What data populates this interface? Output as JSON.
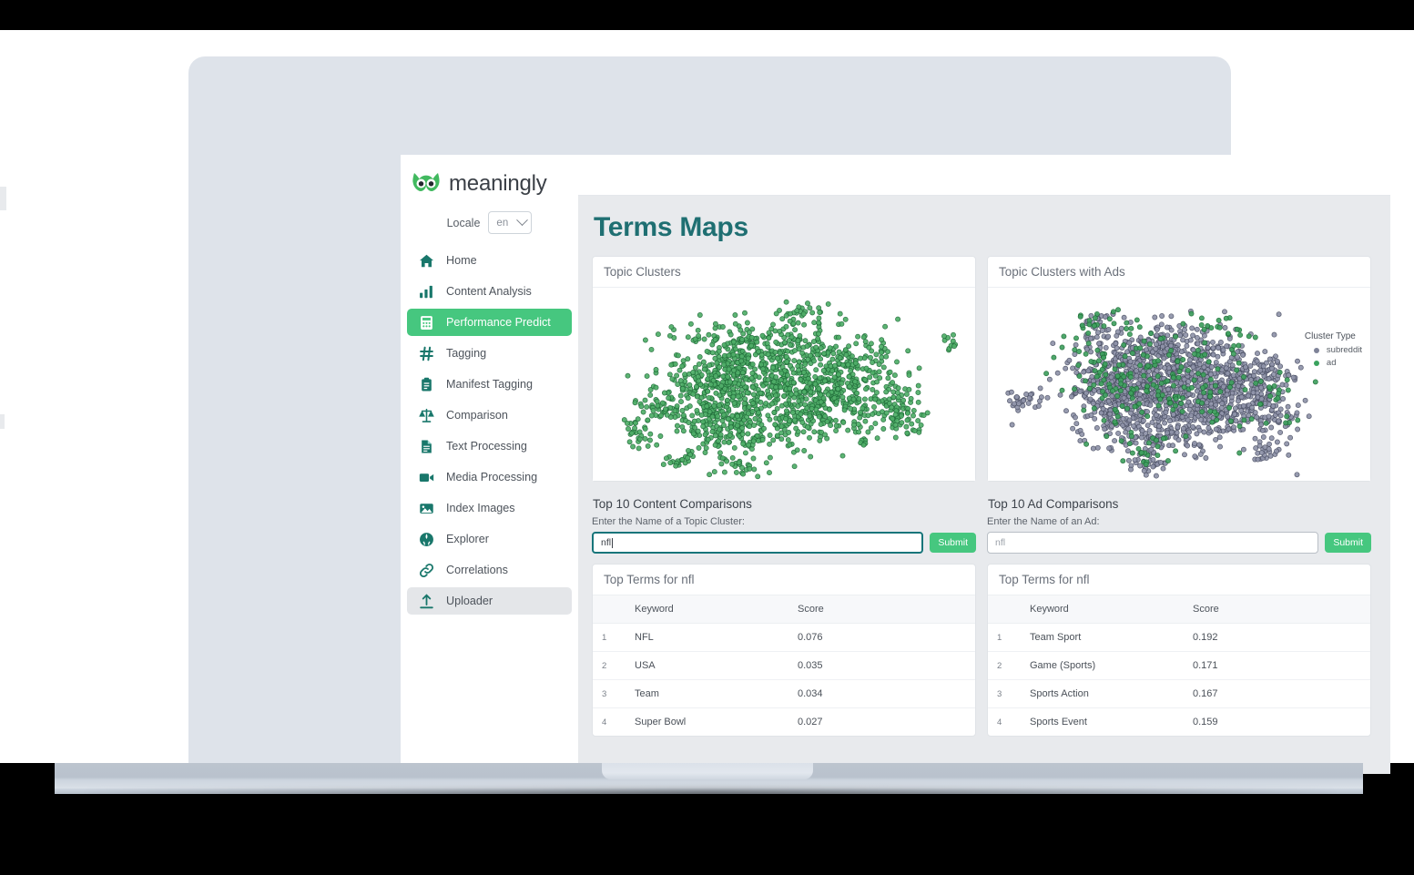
{
  "brand": {
    "name": "meaningly",
    "logo_icon": "owl-icon"
  },
  "locale": {
    "label": "Locale",
    "value": "en",
    "chevron_icon": "chevron-down-icon"
  },
  "sidebar": {
    "items": [
      {
        "label": "Home",
        "icon": "home-icon",
        "state": "default"
      },
      {
        "label": "Content Analysis",
        "icon": "bar-chart-icon",
        "state": "default"
      },
      {
        "label": "Performance Predict",
        "icon": "calculator-icon",
        "state": "active"
      },
      {
        "label": "Tagging",
        "icon": "hash-icon",
        "state": "default"
      },
      {
        "label": "Manifest Tagging",
        "icon": "clipboard-icon",
        "state": "default"
      },
      {
        "label": "Comparison",
        "icon": "scales-icon",
        "state": "default"
      },
      {
        "label": "Text Processing",
        "icon": "document-icon",
        "state": "default"
      },
      {
        "label": "Media Processing",
        "icon": "video-camera-icon",
        "state": "default"
      },
      {
        "label": "Index Images",
        "icon": "image-icon",
        "state": "default"
      },
      {
        "label": "Explorer",
        "icon": "globe-icon",
        "state": "default"
      },
      {
        "label": "Correlations",
        "icon": "link-icon",
        "state": "default"
      },
      {
        "label": "Uploader",
        "icon": "upload-icon",
        "state": "hover"
      }
    ]
  },
  "page": {
    "title": "Terms Maps"
  },
  "left_panel": {
    "chart_title": "Topic Clusters",
    "section_title": "Top 10 Content Comparisons",
    "field_label": "Enter the Name of a Topic Cluster:",
    "input_value": "nfl",
    "submit_label": "Submit",
    "table_title": "Top Terms for nfl",
    "columns": [
      "",
      "Keyword",
      "Score"
    ],
    "rows": [
      {
        "index": "1",
        "keyword": "NFL",
        "score": "0.076"
      },
      {
        "index": "2",
        "keyword": "USA",
        "score": "0.035"
      },
      {
        "index": "3",
        "keyword": "Team",
        "score": "0.034"
      },
      {
        "index": "4",
        "keyword": "Super Bowl",
        "score": "0.027"
      }
    ]
  },
  "right_panel": {
    "chart_title": "Topic Clusters with Ads",
    "section_title": "Top 10 Ad Comparisons",
    "field_label": "Enter the Name of an Ad:",
    "input_placeholder": "nfl",
    "submit_label": "Submit",
    "table_title": "Top Terms for nfl",
    "columns": [
      "",
      "Keyword",
      "Score"
    ],
    "rows": [
      {
        "index": "1",
        "keyword": "Team Sport",
        "score": "0.192"
      },
      {
        "index": "2",
        "keyword": "Game (Sports)",
        "score": "0.171"
      },
      {
        "index": "3",
        "keyword": "Sports Action",
        "score": "0.167"
      },
      {
        "index": "4",
        "keyword": "Sports Event",
        "score": "0.159"
      }
    ],
    "legend": {
      "title": "Cluster Type",
      "entries": [
        {
          "label": "subreddit",
          "color": "#7f8398"
        },
        {
          "label": "ad",
          "color": "#3aa35e"
        }
      ]
    }
  },
  "chart_data": [
    {
      "type": "scatter",
      "title": "Topic Clusters",
      "series": [
        {
          "name": "subreddit",
          "color": "#49a863",
          "point_count": 1400
        }
      ],
      "xlabel": "",
      "ylabel": "",
      "grid": false,
      "legend_position": "none"
    },
    {
      "type": "scatter",
      "title": "Topic Clusters with Ads",
      "series": [
        {
          "name": "subreddit",
          "color": "#7f8398",
          "point_count": 1500
        },
        {
          "name": "ad",
          "color": "#3aa35e",
          "point_count": 300
        }
      ],
      "xlabel": "",
      "ylabel": "",
      "grid": false,
      "legend_position": "right"
    }
  ],
  "theme": {
    "accent_green": "#46c77f",
    "icon_teal": "#19776b",
    "title_teal": "#1f6f72",
    "screen_bg": "#e8eaed"
  }
}
